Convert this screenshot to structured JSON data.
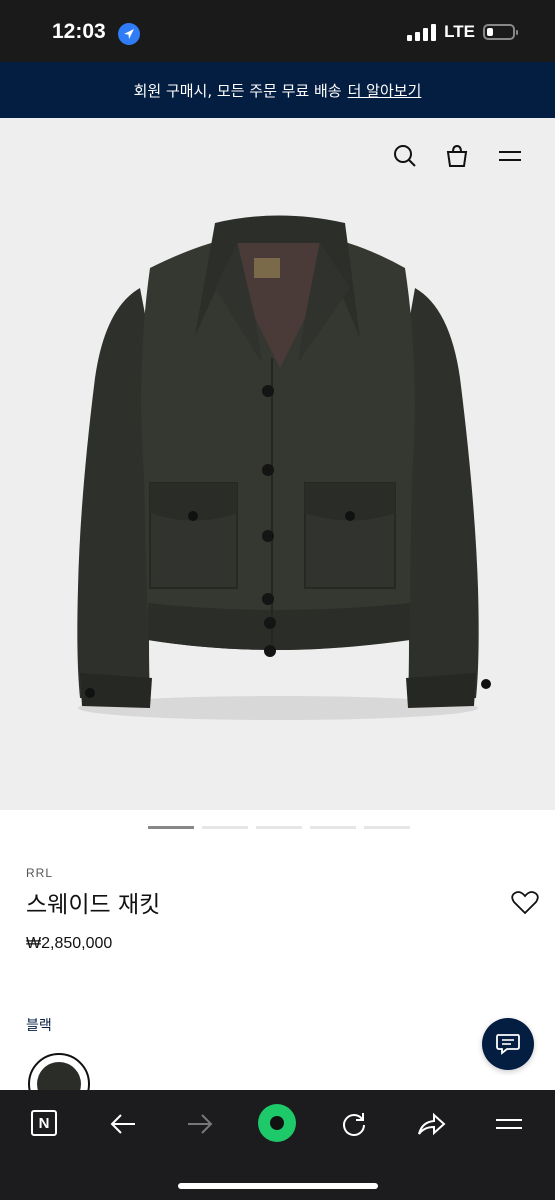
{
  "status_bar": {
    "time": "12:03",
    "network": "LTE"
  },
  "promo_banner": {
    "text": "회원 구매시, 모든 주문 무료 배송",
    "link": "더 알아보기"
  },
  "header_icons": [
    "search-icon",
    "shopping-bag-icon",
    "menu-icon"
  ],
  "carousel": {
    "total": 5,
    "active_index": 0
  },
  "product": {
    "brand": "RRL",
    "title": "스웨이드 재킷",
    "price": "₩2,850,000",
    "color_label": "블랙",
    "swatch_color": "#2b2d29"
  },
  "colors": {
    "navy": "#041e42",
    "green_home": "#1ec96a"
  },
  "browser_toolbar": [
    "naver-n-icon",
    "back-arrow-icon",
    "forward-arrow-icon",
    "home-icon",
    "refresh-icon",
    "share-icon",
    "menu-icon"
  ]
}
